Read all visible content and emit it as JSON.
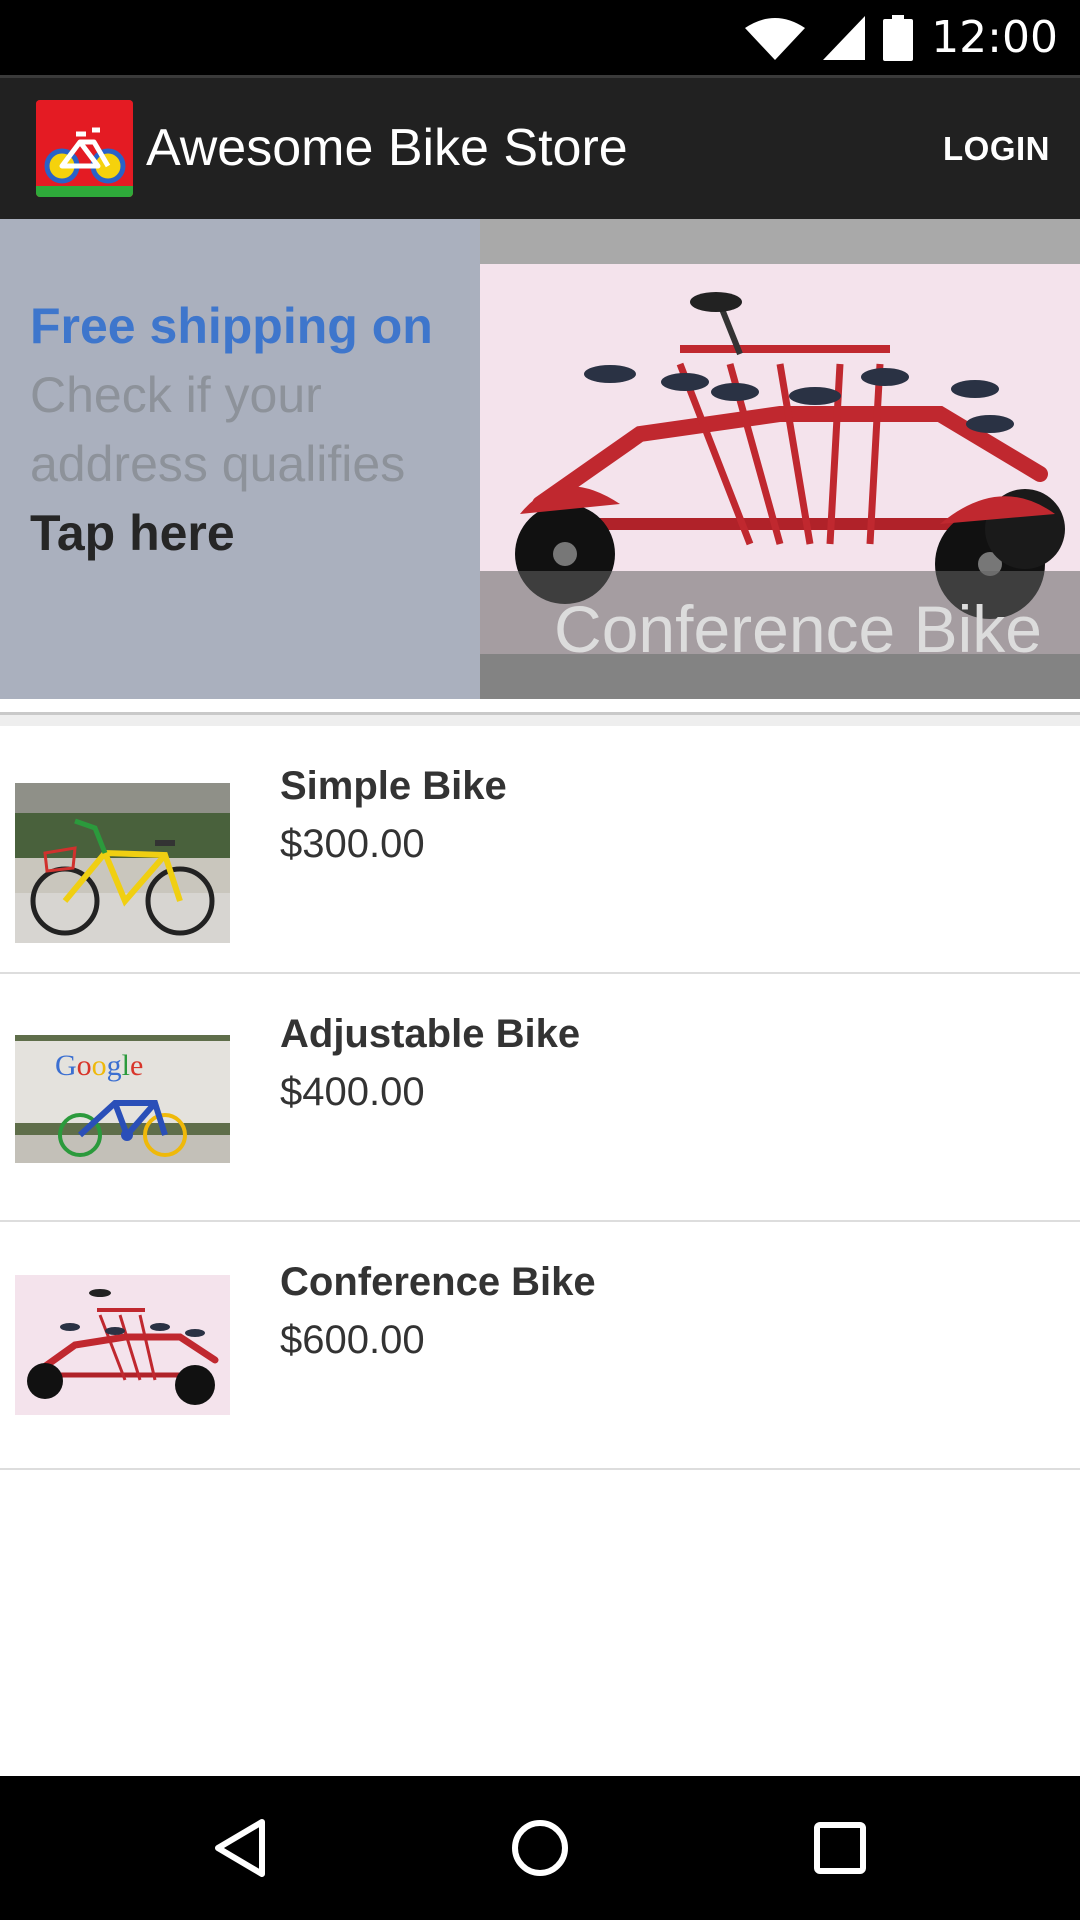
{
  "status_bar": {
    "time": "12:00",
    "icons": [
      "wifi-icon",
      "cell-signal-icon",
      "battery-icon"
    ]
  },
  "app_bar": {
    "title": "Awesome Bike Store",
    "login_label": "LOGIN",
    "logo_icon": "bike-store-logo",
    "background": "#212121"
  },
  "promo": {
    "headline": "Free shipping on",
    "body": "Check if your address qualifies",
    "cta": "Tap here",
    "featured_caption": "Conference Bike",
    "colors": {
      "panel": "#aab0be",
      "headline": "#3e76cc",
      "body": "#8d929a"
    }
  },
  "products": [
    {
      "name": "Simple Bike",
      "price": "$300.00"
    },
    {
      "name": "Adjustable Bike",
      "price": "$400.00"
    },
    {
      "name": "Conference Bike",
      "price": "$600.00"
    }
  ],
  "nav_bar": {
    "buttons": [
      "back-icon",
      "home-icon",
      "recents-icon"
    ]
  }
}
